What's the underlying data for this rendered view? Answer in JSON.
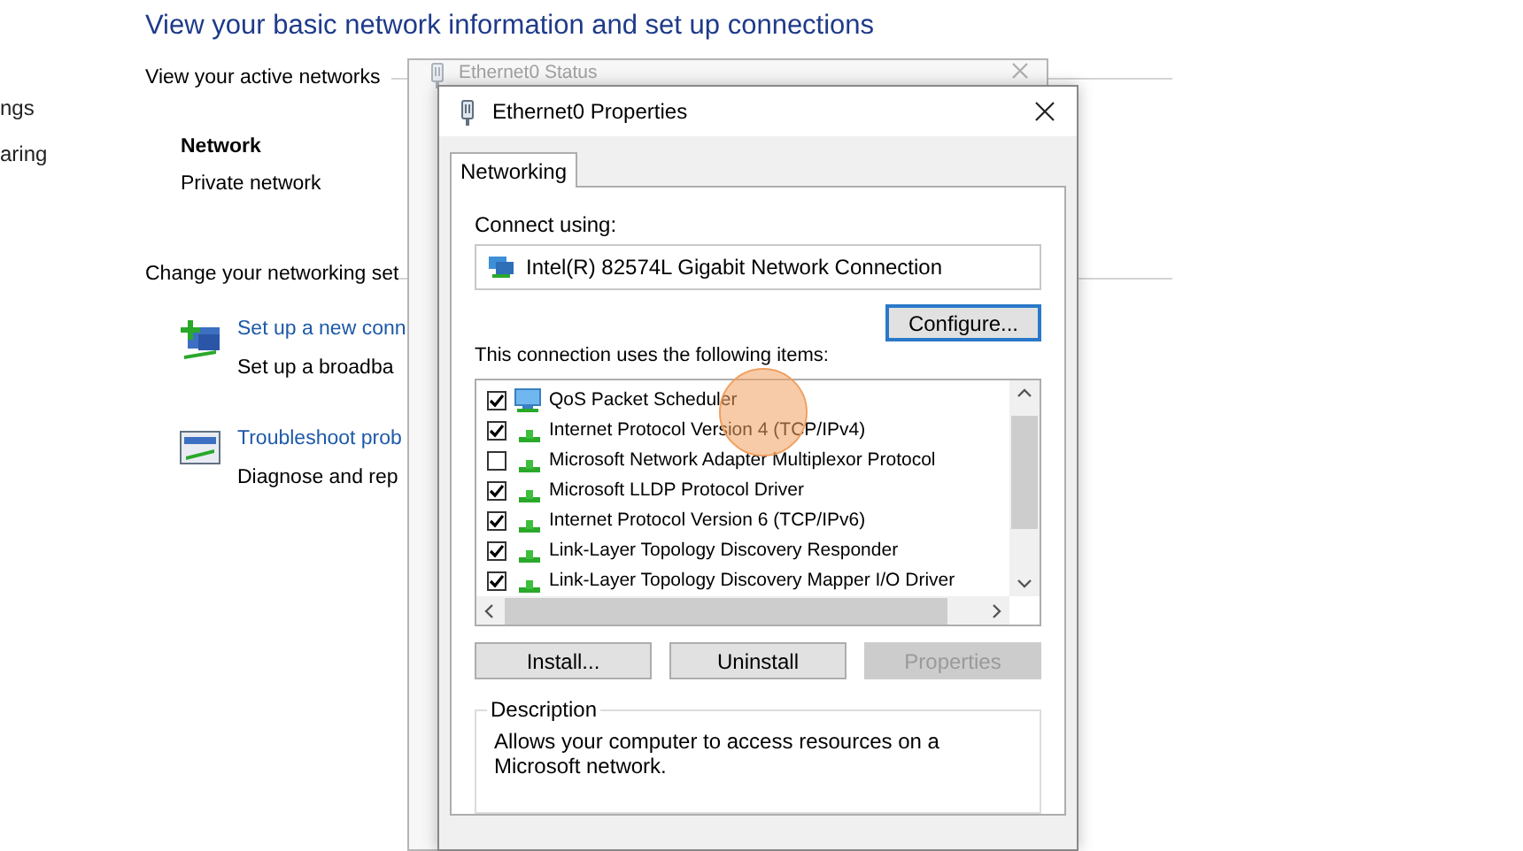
{
  "sidebar": {
    "items": [
      "ngs",
      "aring"
    ]
  },
  "main": {
    "title": "View your basic network information and set up connections",
    "active_networks_label": "View your active networks",
    "network": {
      "name": "Network",
      "type": "Private network"
    },
    "change_settings_label": "Change your networking set",
    "tasks": [
      {
        "kind": "new-connection",
        "link": "Set up a new conn",
        "description": "Set up a broadba"
      },
      {
        "kind": "troubleshoot",
        "link": "Troubleshoot prob",
        "description": "Diagnose and rep"
      }
    ]
  },
  "status_window": {
    "title": "Ethernet0 Status"
  },
  "dialog": {
    "title": "Ethernet0 Properties",
    "tabs": [
      {
        "label": "Networking",
        "selected": true
      }
    ],
    "connect_using_label": "Connect using:",
    "adapter": "Intel(R) 82574L Gigabit Network Connection",
    "configure_button": "Configure...",
    "items_label": "This connection uses the following items:",
    "items": [
      {
        "kind": "service",
        "label": "QoS Packet Scheduler",
        "checked": true
      },
      {
        "kind": "protocol",
        "label": "Internet Protocol Version 4 (TCP/IPv4)",
        "checked": true
      },
      {
        "kind": "protocol",
        "label": "Microsoft Network Adapter Multiplexor Protocol",
        "checked": false
      },
      {
        "kind": "protocol",
        "label": "Microsoft LLDP Protocol Driver",
        "checked": true
      },
      {
        "kind": "protocol",
        "label": "Internet Protocol Version 6 (TCP/IPv6)",
        "checked": true
      },
      {
        "kind": "protocol",
        "label": "Link-Layer Topology Discovery Responder",
        "checked": true
      },
      {
        "kind": "protocol",
        "label": "Link-Layer Topology Discovery Mapper I/O Driver",
        "checked": true
      }
    ],
    "buttons": [
      {
        "label": "Install...",
        "disabled": false
      },
      {
        "label": "Uninstall",
        "disabled": false
      },
      {
        "label": "Properties",
        "disabled": true
      }
    ],
    "description": {
      "legend": "Description",
      "text": "Allows your computer to access resources on a Microsoft network."
    }
  },
  "click_highlight": true
}
